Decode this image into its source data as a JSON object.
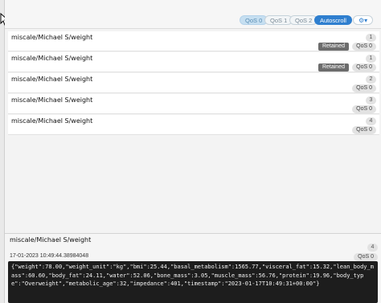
{
  "toolbar": {
    "qos_buttons": [
      "QoS 0",
      "QoS 1",
      "QoS 2"
    ],
    "autoscroll_label": "Autoscroll",
    "settings_icon": "gear-icon",
    "settings_glyph": "⚙▾"
  },
  "messages": [
    {
      "topic": "miscale/Michael S/weight",
      "count": "1",
      "retained": "Retained",
      "qos": "QoS 0"
    },
    {
      "topic": "miscale/Michael S/weight",
      "count": "1",
      "retained": "Retained",
      "qos": "QoS 0"
    },
    {
      "topic": "miscale/Michael S/weight",
      "count": "2",
      "retained": "",
      "qos": "QoS 0"
    },
    {
      "topic": "miscale/Michael S/weight",
      "count": "3",
      "retained": "",
      "qos": "QoS 0"
    },
    {
      "topic": "miscale/Michael S/weight",
      "count": "4",
      "retained": "",
      "qos": "QoS 0"
    }
  ],
  "detail": {
    "topic": "miscale/Michael S/weight",
    "count": "4",
    "timestamp": "17-01-2023  10:49:44.38984048",
    "qos": "QoS 0",
    "payload": "{\"weight\":78.00,\"weight_unit\":\"kg\",\"bmi\":25.44,\"basal_metabolism\":1565.77,\"visceral_fat\":15.32,\"lean_body_mass\":60.60,\"body_fat\":24.11,\"water\":52.06,\"bone_mass\":3.05,\"muscle_mass\":56.76,\"protein\":19.96,\"body_type\":\"Overweight\",\"metabolic_age\":32,\"impedance\":401,\"timestamp\":\"2023-01-17T10:49:31+00:00\"}"
  },
  "colors": {
    "accent": "#2f7fcf",
    "retained_badge": "#6c6c6c",
    "payload_bg": "#1d1d1d"
  }
}
